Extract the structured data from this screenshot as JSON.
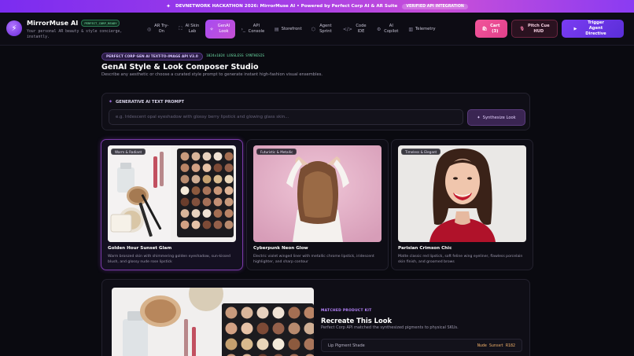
{
  "banner": {
    "text": "DEVNETWORK HACKATHON 2026: MirrorMuse AI • Powered by Perfect Corp AI & AR Suite",
    "badge": "VERIFIED API INTEGRATION"
  },
  "brand": {
    "name": "MirrorMuse AI",
    "status": "PERFECT_CORP_READY",
    "tagline": "Your personal AR beauty & style concierge, instantly."
  },
  "nav": [
    {
      "label": "AR Try-On",
      "icon": "camera-icon"
    },
    {
      "label": "AI Skin Lab",
      "icon": "scan-icon"
    },
    {
      "label": "GenAI Look",
      "icon": "sparkle-icon",
      "active": true
    },
    {
      "label": "API Console",
      "icon": "terminal-icon"
    },
    {
      "label": "Storefront",
      "icon": "store-icon"
    },
    {
      "label": "Agent Sprint",
      "icon": "cube-icon"
    },
    {
      "label": "Code IDE",
      "icon": "code-icon"
    },
    {
      "label": "AI Copilot",
      "icon": "bot-icon"
    },
    {
      "label": "Telemetry",
      "icon": "chart-icon"
    }
  ],
  "actions": {
    "cart": "Cart (3)",
    "pitch": "Pitch Cue HUD",
    "trigger": "Trigger Agent Directive"
  },
  "header": {
    "chip": "PERFECT CORP GEN AI TEXT-TO-IMAGE API V3.0",
    "lossless": "1024x1024 LOSSLESS SYNTHESIS",
    "title": "GenAI Style & Look Composer Studio",
    "subtitle": "Describe any aesthetic or choose a curated style prompt to generate instant high-fashion visual ensembles."
  },
  "prompt": {
    "label": "GENERATIVE AI TEXT PROMPT",
    "placeholder": "e.g. Iridescent opal eyeshadow with glossy berry lipstick and glowing glass skin...",
    "button": "Synthesize Look"
  },
  "cards": [
    {
      "tag": "Warm & Radiant",
      "title": "Golden Hour Sunset Glam",
      "desc": "Warm bronzed skin with shimmering golden eyeshadow, sun-kissed blush, and glossy nude rose lipstick",
      "selected": true
    },
    {
      "tag": "Futuristic & Metallic",
      "title": "Cyberpunk Neon Glow",
      "desc": "Electric violet winged liner with metallic chrome lipstick, iridescent highlighter, and sharp contour"
    },
    {
      "tag": "Timeless & Elegant",
      "title": "Parisian Crimson Chic",
      "desc": "Matte classic red lipstick, soft feline wing eyeliner, flawless porcelain skin finish, and groomed brows"
    }
  ],
  "kit": {
    "label": "MATCHED PRODUCT KIT",
    "title": "Recreate This Look",
    "subtitle": "Perfect Corp API matched the synthesized pigments to physical SKUs.",
    "sku_label": "Lip Pigment Shade",
    "sku_value": "Nude Sunset R182"
  }
}
